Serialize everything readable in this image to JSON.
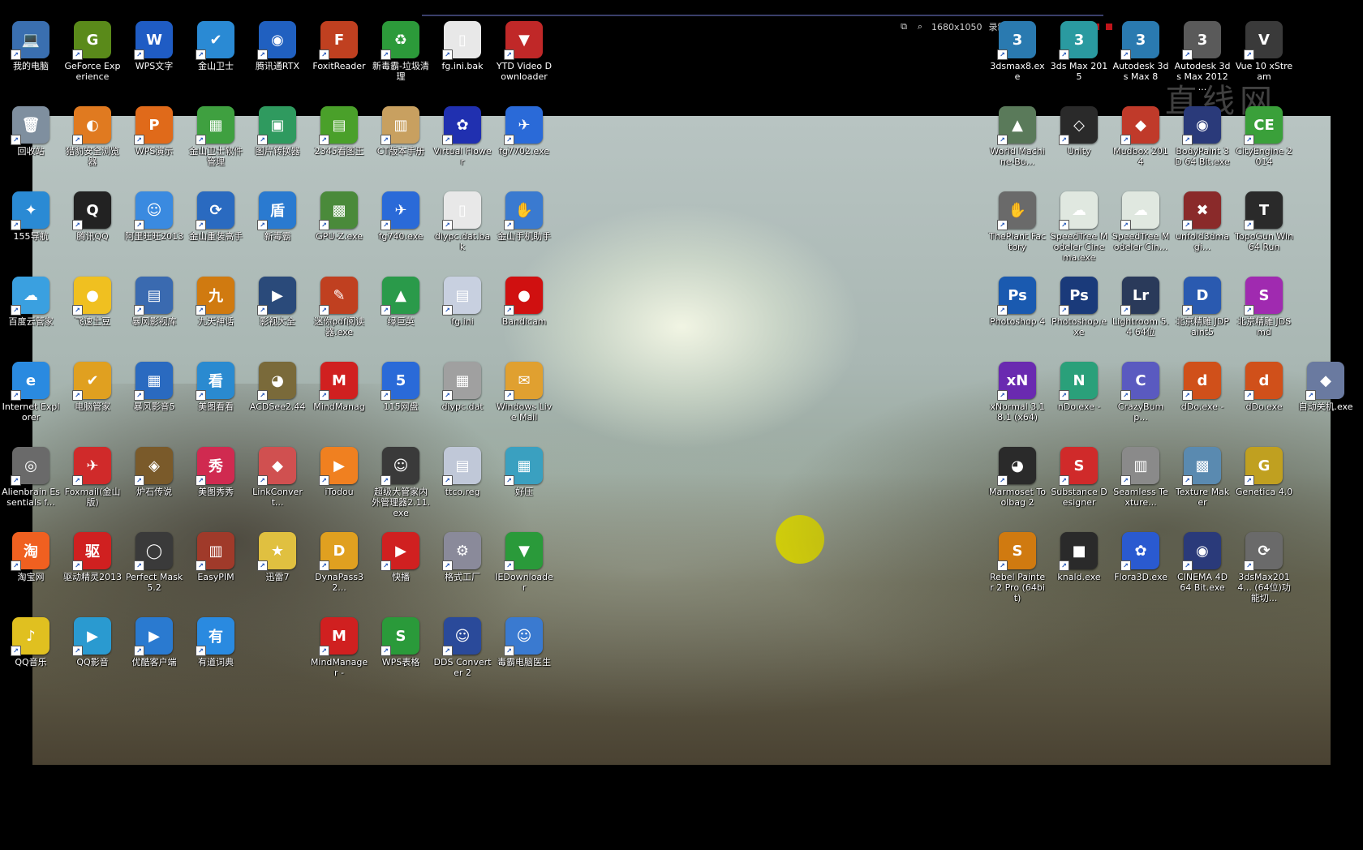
{
  "window": {
    "title": "直线网"
  },
  "recorder_toolbar": {
    "resolution": "1680x1050",
    "status": "录制中"
  },
  "left_icons": [
    {
      "label": "我的电脑",
      "glyph": "💻",
      "color": "#3a6fb0",
      "col": 0,
      "row": 0
    },
    {
      "label": "GeForce Experience",
      "glyph": "G",
      "color": "#5a8a1a",
      "col": 1,
      "row": 0
    },
    {
      "label": "WPS文字",
      "glyph": "W",
      "color": "#1f5cc4",
      "col": 2,
      "row": 0
    },
    {
      "label": "金山卫士",
      "glyph": "✔",
      "color": "#2a8ad4",
      "col": 3,
      "row": 0
    },
    {
      "label": "腾讯通RTX",
      "glyph": "◉",
      "color": "#2060c0",
      "col": 4,
      "row": 0
    },
    {
      "label": "FoxitReader",
      "glyph": "F",
      "color": "#c04020",
      "col": 5,
      "row": 0
    },
    {
      "label": "新毒霸-垃圾清理",
      "glyph": "♻",
      "color": "#2c9a3a",
      "col": 6,
      "row": 0
    },
    {
      "label": "fg.ini.bak",
      "glyph": "▯",
      "color": "#e8e8e8",
      "col": 7,
      "row": 0
    },
    {
      "label": "YTD Video Downloader",
      "glyph": "▼",
      "color": "#c02828",
      "col": 8,
      "row": 0
    },
    {
      "label": "回收站",
      "glyph": "🗑",
      "color": "#7f8f9f",
      "col": 0,
      "row": 1
    },
    {
      "label": "猎豹安全浏览器",
      "glyph": "◐",
      "color": "#e07a20",
      "col": 1,
      "row": 1
    },
    {
      "label": "WPS演示",
      "glyph": "P",
      "color": "#e06a1a",
      "col": 2,
      "row": 1
    },
    {
      "label": "金山卫士软件管理",
      "glyph": "▦",
      "color": "#3fa040",
      "col": 3,
      "row": 1
    },
    {
      "label": "图片转换器",
      "glyph": "▣",
      "color": "#2f9a5f",
      "col": 4,
      "row": 1
    },
    {
      "label": "2345看图王",
      "glyph": "▤",
      "color": "#4aa02a",
      "col": 5,
      "row": 1
    },
    {
      "label": "CT版本手册",
      "glyph": "▥",
      "color": "#c8a060",
      "col": 6,
      "row": 1
    },
    {
      "label": "Virtual Flower",
      "glyph": "✿",
      "color": "#2030b0",
      "col": 7,
      "row": 1
    },
    {
      "label": "fg7702.exe",
      "glyph": "✈",
      "color": "#2a6ad8",
      "col": 8,
      "row": 1
    },
    {
      "label": "155导航",
      "glyph": "✦",
      "color": "#2a8ad4",
      "col": 0,
      "row": 2
    },
    {
      "label": "腾讯QQ",
      "glyph": "Q",
      "color": "#222222",
      "col": 1,
      "row": 2
    },
    {
      "label": "阿里旺旺2013",
      "glyph": "☺",
      "color": "#3a8ae0",
      "col": 2,
      "row": 2
    },
    {
      "label": "金山重装高手",
      "glyph": "⟳",
      "color": "#2a6ac0",
      "col": 3,
      "row": 2
    },
    {
      "label": "新毒霸",
      "glyph": "盾",
      "color": "#2a7ad0",
      "col": 4,
      "row": 2
    },
    {
      "label": "GPU-Z.exe",
      "glyph": "▩",
      "color": "#4a8a3a",
      "col": 5,
      "row": 2
    },
    {
      "label": "fg740.exe",
      "glyph": "✈",
      "color": "#2a6ad8",
      "col": 6,
      "row": 2
    },
    {
      "label": "diypc.dat.bak",
      "glyph": "▯",
      "color": "#e8e8e8",
      "col": 7,
      "row": 2
    },
    {
      "label": "金山手机助手",
      "glyph": "✋",
      "color": "#3a7ad0",
      "col": 8,
      "row": 2
    },
    {
      "label": "百度云管家",
      "glyph": "☁",
      "color": "#3aa0e0",
      "col": 0,
      "row": 3
    },
    {
      "label": "飞速土豆",
      "glyph": "●",
      "color": "#f0c020",
      "col": 1,
      "row": 3
    },
    {
      "label": "暴风影视库",
      "glyph": "▤",
      "color": "#3a6ab0",
      "col": 2,
      "row": 3
    },
    {
      "label": "九天神话",
      "glyph": "九",
      "color": "#d07a10",
      "col": 3,
      "row": 3
    },
    {
      "label": "影视大全",
      "glyph": "▶",
      "color": "#2a4a7a",
      "col": 4,
      "row": 3
    },
    {
      "label": "迷你pdf阅读器.exe",
      "glyph": "✎",
      "color": "#c04020",
      "col": 5,
      "row": 3
    },
    {
      "label": "绿巨英",
      "glyph": "▲",
      "color": "#2a9a4a",
      "col": 6,
      "row": 3
    },
    {
      "label": "fg.ini",
      "glyph": "▤",
      "color": "#c8d0e0",
      "col": 7,
      "row": 3
    },
    {
      "label": "Bandicam",
      "glyph": "●",
      "color": "#d01010",
      "col": 8,
      "row": 3
    },
    {
      "label": "Internet Explorer",
      "glyph": "e",
      "color": "#2a8ae0",
      "col": 0,
      "row": 4
    },
    {
      "label": "电脑管家",
      "glyph": "✔",
      "color": "#e0a020",
      "col": 1,
      "row": 4
    },
    {
      "label": "暴风影音5",
      "glyph": "▦",
      "color": "#2a6ac0",
      "col": 2,
      "row": 4
    },
    {
      "label": "美图看看",
      "glyph": "看",
      "color": "#2a8ad0",
      "col": 3,
      "row": 4
    },
    {
      "label": "ACDSee2.44",
      "glyph": "◕",
      "color": "#7a6a3a",
      "col": 4,
      "row": 4
    },
    {
      "label": "MindManag",
      "glyph": "M",
      "color": "#d02020",
      "col": 5,
      "row": 4
    },
    {
      "label": "115网盘",
      "glyph": "5",
      "color": "#2a6ad8",
      "col": 6,
      "row": 4
    },
    {
      "label": "diypc.dat",
      "glyph": "▦",
      "color": "#a0a0a0",
      "col": 7,
      "row": 4
    },
    {
      "label": "Windows Live Mail",
      "glyph": "✉",
      "color": "#e0a030",
      "col": 8,
      "row": 4
    },
    {
      "label": "Alienbrain Essentials f...",
      "glyph": "◎",
      "color": "#6a6a6a",
      "col": 0,
      "row": 5
    },
    {
      "label": "Foxmail(金山版)",
      "glyph": "✈",
      "color": "#d02a2a",
      "col": 1,
      "row": 5
    },
    {
      "label": "炉石传说",
      "glyph": "◈",
      "color": "#7a5a2a",
      "col": 2,
      "row": 5
    },
    {
      "label": "美图秀秀",
      "glyph": "秀",
      "color": "#d02a50",
      "col": 3,
      "row": 5
    },
    {
      "label": "LinkConvert...",
      "glyph": "◆",
      "color": "#d05050",
      "col": 4,
      "row": 5
    },
    {
      "label": "iTodou",
      "glyph": "▶",
      "color": "#f08020",
      "col": 5,
      "row": 5
    },
    {
      "label": "超级大管家内外管理器2.11.exe",
      "glyph": "☺",
      "color": "#3a3a3a",
      "col": 6,
      "row": 5
    },
    {
      "label": "ttco.reg",
      "glyph": "▤",
      "color": "#c0c8d8",
      "col": 7,
      "row": 5
    },
    {
      "label": "好压",
      "glyph": "▦",
      "color": "#3aa0c0",
      "col": 8,
      "row": 5
    },
    {
      "label": "淘宝网",
      "glyph": "淘",
      "color": "#f06020",
      "col": 0,
      "row": 6
    },
    {
      "label": "驱动精灵2013",
      "glyph": "驱",
      "color": "#d02020",
      "col": 1,
      "row": 6
    },
    {
      "label": "Perfect Mask 5.2",
      "glyph": "◯",
      "color": "#3a3a3a",
      "col": 2,
      "row": 6
    },
    {
      "label": "EasyPIM",
      "glyph": "▥",
      "color": "#a03a2a",
      "col": 3,
      "row": 6
    },
    {
      "label": "迅雷7",
      "glyph": "★",
      "color": "#e0c040",
      "col": 4,
      "row": 6
    },
    {
      "label": "DynaPass32...",
      "glyph": "D",
      "color": "#e0a020",
      "col": 5,
      "row": 6
    },
    {
      "label": "快播",
      "glyph": "▶",
      "color": "#d02020",
      "col": 6,
      "row": 6
    },
    {
      "label": "格式工厂",
      "glyph": "⚙",
      "color": "#8a8a9a",
      "col": 7,
      "row": 6
    },
    {
      "label": "IEDownloader",
      "glyph": "▼",
      "color": "#2a9a3a",
      "col": 8,
      "row": 6
    },
    {
      "label": "QQ音乐",
      "glyph": "♪",
      "color": "#e0c020",
      "col": 0,
      "row": 7
    },
    {
      "label": "QQ影音",
      "glyph": "▶",
      "color": "#2a9ad0",
      "col": 1,
      "row": 7
    },
    {
      "label": "优酷客户端",
      "glyph": "▶",
      "color": "#2a7ad0",
      "col": 2,
      "row": 7
    },
    {
      "label": "有道词典",
      "glyph": "有",
      "color": "#2a8ae0",
      "col": 3,
      "row": 7
    },
    {
      "label": "MindManager -",
      "glyph": "M",
      "color": "#d02020",
      "col": 5,
      "row": 7
    },
    {
      "label": "WPS表格",
      "glyph": "S",
      "color": "#2a9a3a",
      "col": 6,
      "row": 7
    },
    {
      "label": "DDS Converter 2",
      "glyph": "☺",
      "color": "#2a4a9a",
      "col": 7,
      "row": 7
    },
    {
      "label": "毒霸电脑医生",
      "glyph": "☺",
      "color": "#3a7ad0",
      "col": 8,
      "row": 7
    }
  ],
  "right_icons": [
    {
      "label": "3dsmax8.exe",
      "glyph": "3",
      "color": "#2a7ab0",
      "col": 0,
      "row": 0
    },
    {
      "label": "3ds Max 2015",
      "glyph": "3",
      "color": "#2a9aa0",
      "col": 1,
      "row": 0
    },
    {
      "label": "Autodesk 3ds Max 8",
      "glyph": "3",
      "color": "#2a7ab0",
      "col": 2,
      "row": 0
    },
    {
      "label": "Autodesk 3ds Max 2012 ...",
      "glyph": "3",
      "color": "#5a5a5a",
      "col": 3,
      "row": 0
    },
    {
      "label": "Vue 10 xStream",
      "glyph": "V",
      "color": "#3a3a3a",
      "col": 4,
      "row": 0
    },
    {
      "label": "World Machine-Bu...",
      "glyph": "▲",
      "color": "#5a7a5a",
      "col": 0,
      "row": 1
    },
    {
      "label": "Unity",
      "glyph": "◇",
      "color": "#2a2a2a",
      "col": 1,
      "row": 1
    },
    {
      "label": "Mudbox 2014",
      "glyph": "◆",
      "color": "#c03a2a",
      "col": 2,
      "row": 1
    },
    {
      "label": "BodyPaint 3D 64 Bit.exe",
      "glyph": "◉",
      "color": "#2a3a7a",
      "col": 3,
      "row": 1
    },
    {
      "label": "CityEngine 2014",
      "glyph": "CE",
      "color": "#3aa03a",
      "col": 4,
      "row": 1
    },
    {
      "label": "ThePlant Factory",
      "glyph": "✋",
      "color": "#6a6a6a",
      "col": 0,
      "row": 2
    },
    {
      "label": "SpeedTree Modeler Cinema.exe",
      "glyph": "☁",
      "color": "#e0e8e0",
      "col": 1,
      "row": 2
    },
    {
      "label": "SpeedTree Modeler Cin...",
      "glyph": "☁",
      "color": "#e0e8e0",
      "col": 2,
      "row": 2
    },
    {
      "label": "unfold3dmagi...",
      "glyph": "✖",
      "color": "#8a2a2a",
      "col": 3,
      "row": 2
    },
    {
      "label": "TopoGun Win64 Run",
      "glyph": "T",
      "color": "#2a2a2a",
      "col": 4,
      "row": 2
    },
    {
      "label": "Photoshop 4",
      "glyph": "Ps",
      "color": "#1a5ab0",
      "col": 0,
      "row": 3
    },
    {
      "label": "Photoshop.exe",
      "glyph": "Ps",
      "color": "#1a3a7a",
      "col": 1,
      "row": 3
    },
    {
      "label": "Lightroom 5.4 64位",
      "glyph": "Lr",
      "color": "#2a3a5a",
      "col": 2,
      "row": 3
    },
    {
      "label": "北京精雕 JDPaint5",
      "glyph": "D",
      "color": "#2a5ab0",
      "col": 3,
      "row": 3
    },
    {
      "label": "北京精雕 JDSmd",
      "glyph": "S",
      "color": "#a02ab0",
      "col": 4,
      "row": 3
    },
    {
      "label": "xNormal 3.18.1 (x64)",
      "glyph": "xN",
      "color": "#6a2ab0",
      "col": 0,
      "row": 4
    },
    {
      "label": "nDo.exe -",
      "glyph": "N",
      "color": "#2aa07a",
      "col": 1,
      "row": 4
    },
    {
      "label": "CrazyBump...",
      "glyph": "C",
      "color": "#5a5ac0",
      "col": 2,
      "row": 4
    },
    {
      "label": "dDo.exe -",
      "glyph": "d",
      "color": "#d0501a",
      "col": 3,
      "row": 4
    },
    {
      "label": "dDo.exe",
      "glyph": "d",
      "color": "#d0501a",
      "col": 4,
      "row": 4
    },
    {
      "label": "自动关机.exe",
      "glyph": "◆",
      "color": "#6a7aa0",
      "col": 5,
      "row": 4
    },
    {
      "label": "Marmoset Toolbag 2",
      "glyph": "◕",
      "color": "#2a2a2a",
      "col": 0,
      "row": 5
    },
    {
      "label": "Substance Designer",
      "glyph": "S",
      "color": "#d02a2a",
      "col": 1,
      "row": 5
    },
    {
      "label": "Seamless Texture...",
      "glyph": "▥",
      "color": "#8a8a8a",
      "col": 2,
      "row": 5
    },
    {
      "label": "Texture Maker",
      "glyph": "▩",
      "color": "#5a8ab0",
      "col": 3,
      "row": 5
    },
    {
      "label": "Genetica 4.0",
      "glyph": "G",
      "color": "#c0a020",
      "col": 4,
      "row": 5
    },
    {
      "label": "Rebel Painter 2 Pro (64bit)",
      "glyph": "S",
      "color": "#d07a10",
      "col": 0,
      "row": 6
    },
    {
      "label": "knald.exe",
      "glyph": "■",
      "color": "#2a2a2a",
      "col": 1,
      "row": 6
    },
    {
      "label": "Flora3D.exe",
      "glyph": "✿",
      "color": "#2a5ad0",
      "col": 2,
      "row": 6
    },
    {
      "label": "CINEMA 4D 64 Bit.exe",
      "glyph": "◉",
      "color": "#2a3a7a",
      "col": 3,
      "row": 6
    },
    {
      "label": "3dsMax2014... (64位)功能切...",
      "glyph": "⟳",
      "color": "#6a6a6a",
      "col": 4,
      "row": 6
    }
  ]
}
